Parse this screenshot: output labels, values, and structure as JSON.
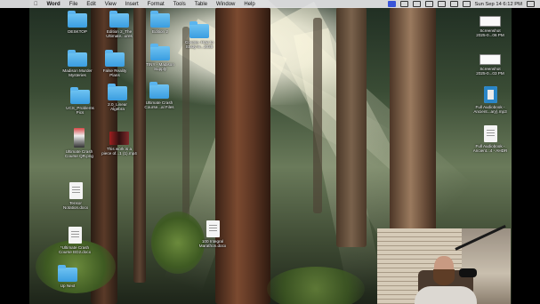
{
  "menubar": {
    "app": "Word",
    "menus": [
      "File",
      "Edit",
      "View",
      "Insert",
      "Format",
      "Tools",
      "Table",
      "Window",
      "Help"
    ],
    "clock": "Sun Sep 14  6:12 PM"
  },
  "desktop": {
    "icons": [
      {
        "label": "DESKTOP",
        "type": "folder"
      },
      {
        "label": "Edition 2_The\nUltimate...ures",
        "type": "folder"
      },
      {
        "label": "Edition 2",
        "type": "folder"
      },
      {
        "label": "Course- How to\nStudy in...2025",
        "type": "folder"
      },
      {
        "label": "Madison Murder\nMysteries",
        "type": "folder"
      },
      {
        "label": "False Reality\nPlans",
        "type": "folder"
      },
      {
        "label": "TINY - Madison\nSupply",
        "type": "folder"
      },
      {
        "label": "UCS_Problems\nPics",
        "type": "folder"
      },
      {
        "label": "2.0_Linear\nAlgebra",
        "type": "folder"
      },
      {
        "label": "Ultimate Crash\nCourse...al Files",
        "type": "folder"
      },
      {
        "label": "Ultimate Crash\nCourse QR.png",
        "type": "qr"
      },
      {
        "label": "This work is a\npiece of...1 (1).mp4",
        "type": "video"
      },
      {
        "label": "Tensor\nNotation.docx",
        "type": "doc"
      },
      {
        "label": "100 Integral\nMarathon.docx",
        "type": "doc"
      },
      {
        "label": "*Ultimate Crash\nCourse ED2.docx",
        "type": "doc"
      },
      {
        "label": "Up Next",
        "type": "folder"
      },
      {
        "label": "Screenshot\n2025-0...06 PM",
        "type": "screenshot"
      },
      {
        "label": "Screenshot\n2025-0...03 PM",
        "type": "screenshot"
      },
      {
        "label": "Full Audiobook -\nAncient...ary).mp3",
        "type": "audio"
      },
      {
        "label": "Full Audiobook -\nAncient...4 - AHDR",
        "type": "doc"
      }
    ]
  }
}
